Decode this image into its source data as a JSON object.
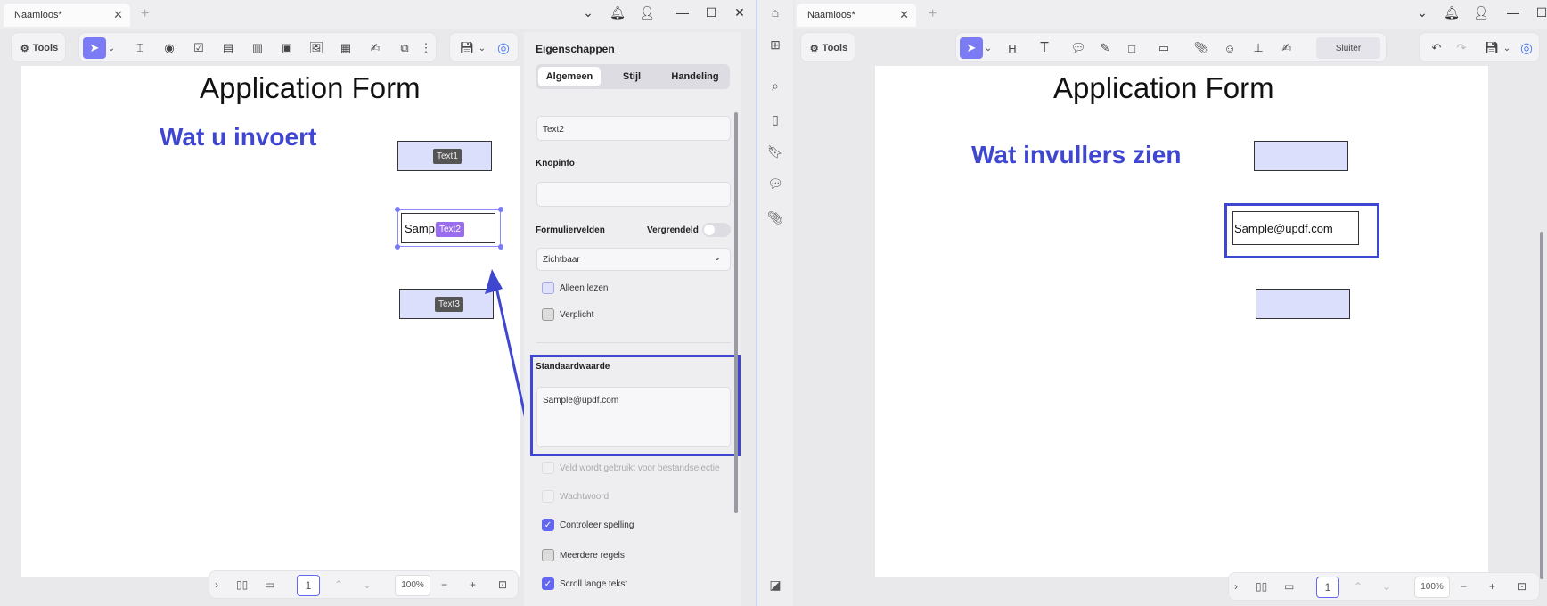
{
  "left": {
    "tab_title": "Naamloos*",
    "tools_label": "Tools",
    "page_title": "Application Form",
    "annotation": "Wat u invoert",
    "fields": {
      "text1": "Text1",
      "text2": "Text2",
      "text3": "Text3",
      "sample_partial": "Sampl"
    },
    "zoom": "100%",
    "page_num": "1"
  },
  "props": {
    "title": "Eigenschappen",
    "tabs": [
      "Algemeen",
      "Stijl",
      "Handeling"
    ],
    "name_value": "Text2",
    "tooltip_label": "Knopinfo",
    "tooltip_value": "",
    "form_fields_label": "Formuliervelden",
    "locked_label": "Vergrendeld",
    "visibility": "Zichtbaar",
    "readonly_label": "Alleen lezen",
    "required_label": "Verplicht",
    "default_label": "Standaardwaarde",
    "default_value": "Sample@updf.com",
    "file_select_label": "Veld wordt gebruikt voor bestandselectie",
    "password_label": "Wachtwoord",
    "spellcheck_label": "Controleer spelling",
    "multiline_label": "Meerdere regels",
    "scroll_label": "Scroll lange tekst"
  },
  "right": {
    "tab_title": "Naamloos*",
    "tools_label": "Tools",
    "close_label": "Sluiter",
    "page_title": "Application Form",
    "annotation": "Wat invullers zien",
    "email_value": "Sample@updf.com",
    "zoom": "100%",
    "page_num": "1"
  },
  "colors": {
    "accent": "#3f47d1",
    "selection": "#7b7cf5",
    "tag_purple": "#9a6cf0"
  }
}
